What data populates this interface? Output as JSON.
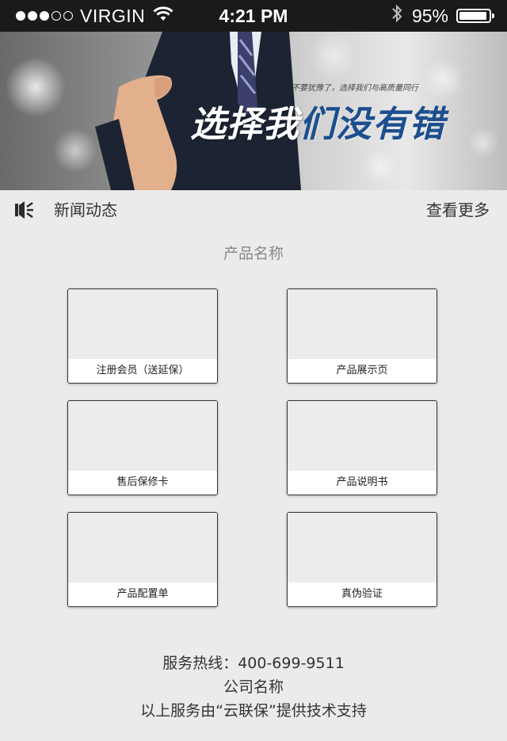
{
  "status_bar": {
    "carrier": "VIRGIN",
    "time": "4:21 PM",
    "battery_percent": "95%",
    "battery_level": 0.95,
    "signal_bars": 3,
    "signal_total": 5
  },
  "banner": {
    "slogan_white": "选择我",
    "slogan_blue": "们没有错",
    "subtitle": "不要犹豫了，选择我们与高质量同行"
  },
  "news": {
    "icon": "speaker-icon",
    "title": "新闻动态",
    "more": "查看更多"
  },
  "section": {
    "title": "产品名称"
  },
  "cards": [
    {
      "label": "注册会员（送延保）"
    },
    {
      "label": "产品展示页"
    },
    {
      "label": "售后保修卡"
    },
    {
      "label": "产品说明书"
    },
    {
      "label": "产品配置单"
    },
    {
      "label": "真伪验证"
    }
  ],
  "footer": {
    "hotline": "服务热线：400-699-9511",
    "company": "公司名称",
    "support": "以上服务由“云联保”提供技术支持"
  },
  "colors": {
    "status_bg": "#1a1a1a",
    "page_bg": "#ebebeb",
    "slogan_blue": "#1d4f8e"
  }
}
